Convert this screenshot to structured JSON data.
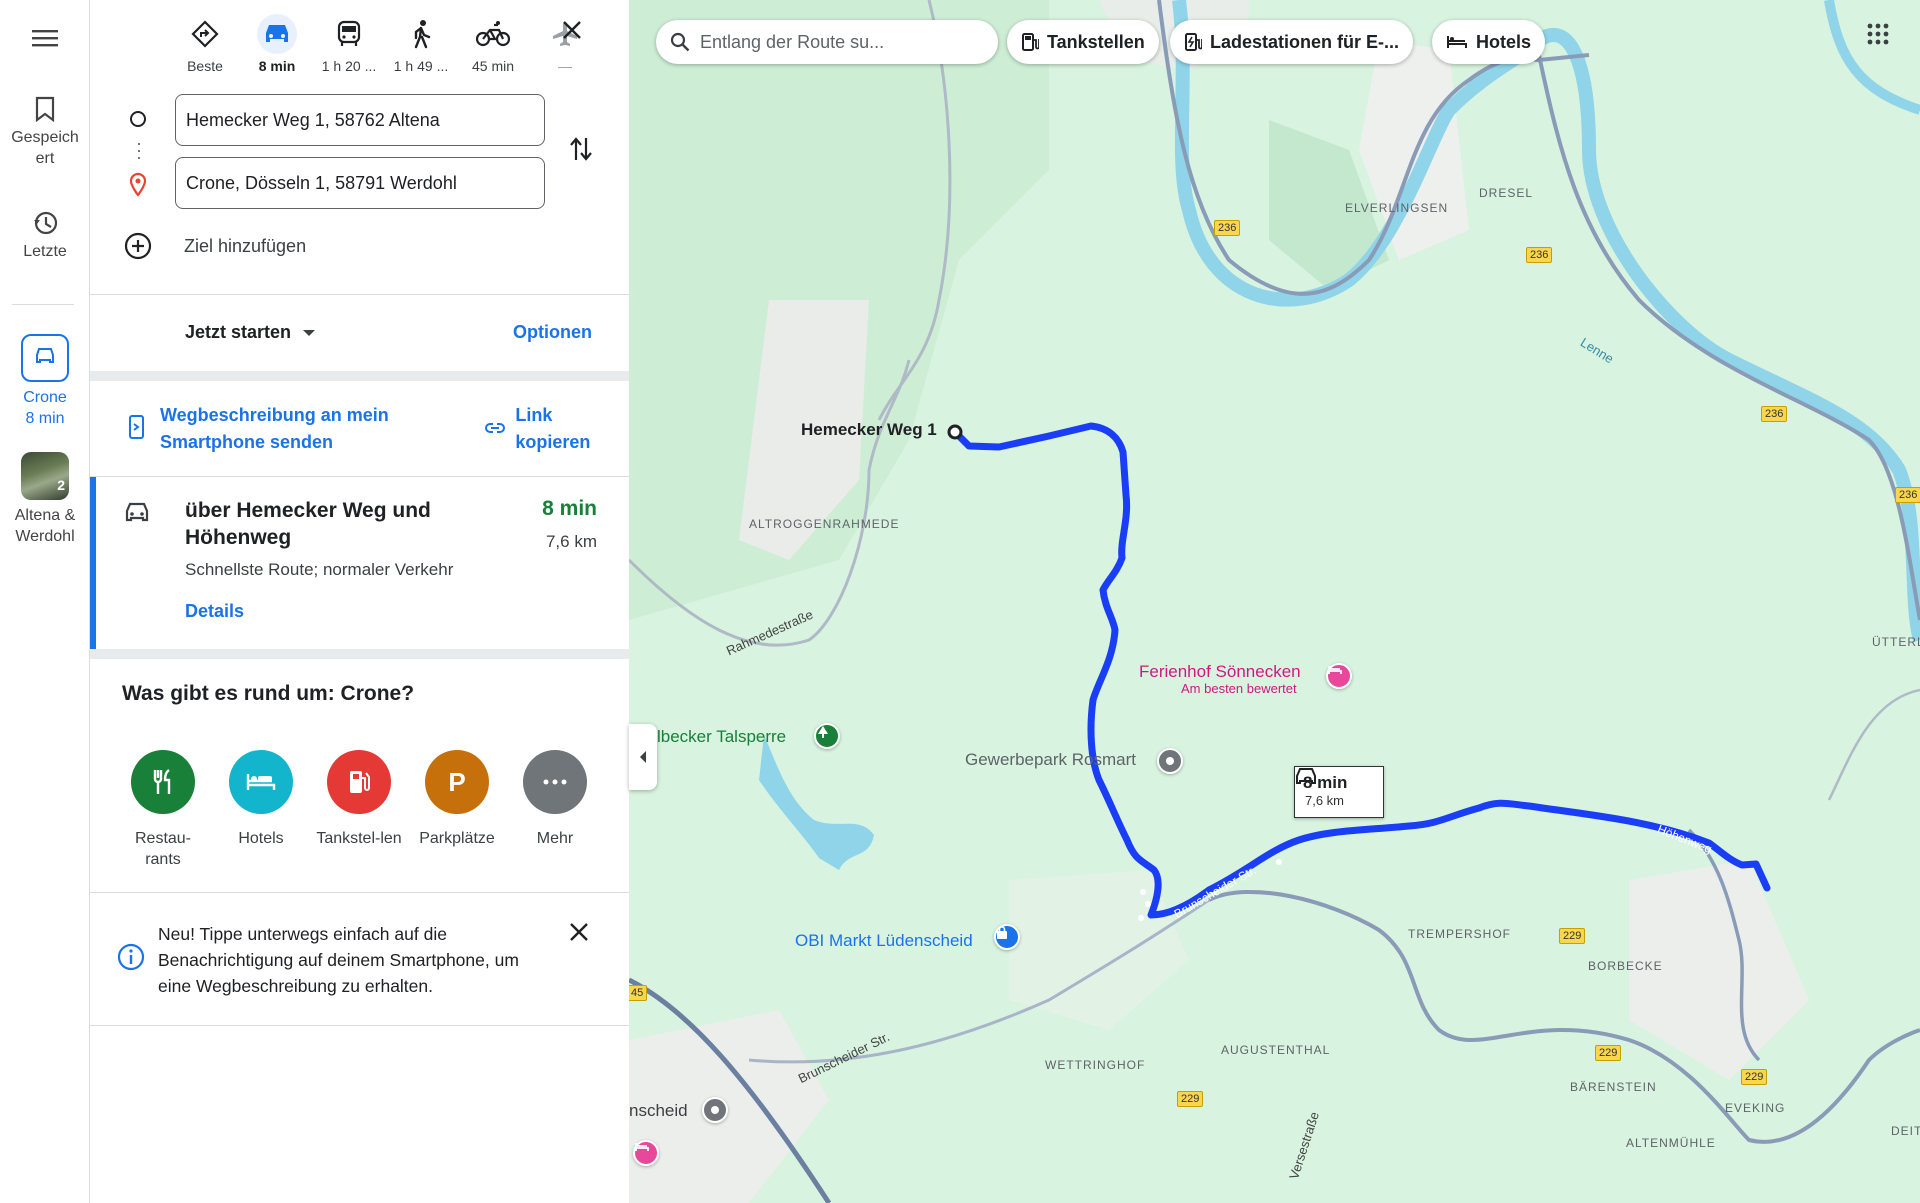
{
  "rail": {
    "saved_label": "Gespeich ert",
    "recent_label": "Letzte",
    "active_trip": {
      "label": "Crone",
      "time": "8 min"
    },
    "collection": {
      "label": "Altena & Werdohl",
      "count": "2"
    }
  },
  "modes": [
    {
      "icon": "best-route-icon",
      "label": "Beste"
    },
    {
      "icon": "car-icon",
      "label": "8 min",
      "active": true
    },
    {
      "icon": "transit-icon",
      "label": "1 h 20 ..."
    },
    {
      "icon": "walk-icon",
      "label": "1 h 49 ..."
    },
    {
      "icon": "bike-icon",
      "label": "45 min"
    },
    {
      "icon": "flight-icon",
      "label": "—"
    }
  ],
  "origin": "Hemecker Weg 1, 58762 Altena",
  "destination": "Crone, Dösseln 1, 58791 Werdohl",
  "add_destination": "Ziel hinzufügen",
  "depart": "Jetzt starten",
  "options": "Optionen",
  "send_phone": "Wegbeschreibung an mein Smartphone senden",
  "copy_link": "Link kopieren",
  "route": {
    "title": "über Hemecker Weg und Höhenweg",
    "time": "8 min",
    "distance": "7,6 km",
    "note": "Schnellste Route; normaler Verkehr",
    "details": "Details"
  },
  "nearby": {
    "title": "Was gibt es rund um: Crone?",
    "items": [
      {
        "label": "Restau-rants",
        "icon": "restaurant-icon",
        "color": "#188038"
      },
      {
        "label": "Hotels",
        "icon": "hotel-icon",
        "color": "#12b5cb"
      },
      {
        "label": "Tankstel-len",
        "icon": "gas-icon",
        "color": "#e53935"
      },
      {
        "label": "Parkplätze",
        "icon": "parking-icon",
        "color": "#c5700a"
      },
      {
        "label": "Mehr",
        "icon": "more-icon",
        "color": "#70757a"
      }
    ]
  },
  "tip": "Neu! Tippe unterwegs einfach auf die Benachrichtigung auf deinem Smartphone, um eine Wegbeschreibung zu erhalten.",
  "map_search_placeholder": "Entlang der Route su...",
  "chips": [
    "Tankstellen",
    "Ladestationen für E-...",
    "Hotels"
  ],
  "map_labels": {
    "start": "Hemecker Weg 1",
    "ferienhof": "Ferienhof Sönnecken",
    "ferienhof_sub": "Am besten bewertet",
    "gewerbepark": "Gewerbepark Rosmart",
    "talsperre": "lbecker Talsperre",
    "obi": "OBI Markt Lüdenscheid",
    "scheid": "nscheid",
    "altroggen": "ALTROGGENRAHMEDE",
    "elverlingsen": "ELVERLINGSEN",
    "dresel": "DRESEL",
    "trempershof": "TREMPERSHOF",
    "borbecke": "BORBECKE",
    "augustenthal": "AUGUSTENTHAL",
    "wettringhof": "WETTRINGHOF",
    "baerenstein": "BÄRENSTEIN",
    "eveking": "EVEKING",
    "altenmuehle": "ALTENMÜHLE",
    "uetter": "ÜTTERL",
    "deit": "DEIT",
    "rahmedestrasse": "Rahmedestraße",
    "brunscheider1": "Brunscheider Str.",
    "brunscheider2": "Brunscheider Str.",
    "hoehenweg": "Höhenweg",
    "lenne": "Lenne",
    "versse": "Versestraße",
    "shield_236": "236",
    "shield_229": "229",
    "shield_45": "45"
  },
  "route_tooltip": {
    "time": "8 min",
    "distance": "7,6 km"
  },
  "colors": {
    "route": "#1a3ef5",
    "accent": "#1a73e8",
    "green_time": "#188038",
    "map_bg": "#d8f3df",
    "river": "#8fd4e8"
  }
}
